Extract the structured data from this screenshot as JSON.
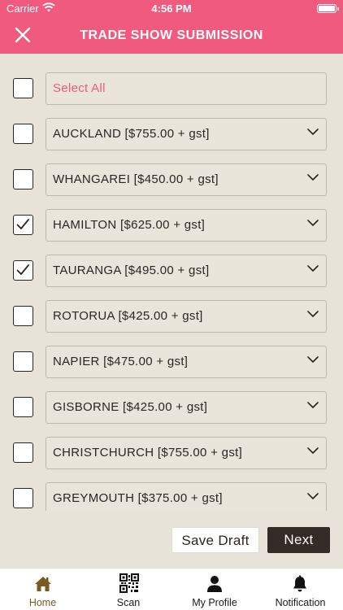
{
  "status_bar": {
    "carrier": "Carrier",
    "time": "4:56 PM"
  },
  "nav": {
    "title": "TRADE SHOW SUBMISSION"
  },
  "select_all": {
    "label": "Select All",
    "checked": false
  },
  "shows": [
    {
      "label": "AUCKLAND [$755.00 + gst]",
      "checked": false
    },
    {
      "label": "WHANGAREI [$450.00 + gst]",
      "checked": false
    },
    {
      "label": "HAMILTON [$625.00 + gst]",
      "checked": true
    },
    {
      "label": "TAURANGA [$495.00 + gst]",
      "checked": true
    },
    {
      "label": "ROTORUA [$425.00 + gst]",
      "checked": false
    },
    {
      "label": "NAPIER [$475.00 + gst]",
      "checked": false
    },
    {
      "label": "GISBORNE [$425.00 + gst]",
      "checked": false
    },
    {
      "label": "CHRISTCHURCH [$755.00 + gst]",
      "checked": false
    },
    {
      "label": "GREYMOUTH [$375.00 + gst]",
      "checked": false
    }
  ],
  "actions": {
    "save_draft": "Save Draft",
    "next": "Next"
  },
  "tabs": [
    {
      "label": "Home",
      "icon": "home-icon",
      "active": true
    },
    {
      "label": "Scan",
      "icon": "qr-code-icon",
      "active": false
    },
    {
      "label": "My Profile",
      "icon": "user-icon",
      "active": false
    },
    {
      "label": "Notification",
      "icon": "bell-icon",
      "active": false
    }
  ],
  "colors": {
    "brand": "#f05a7e",
    "background": "#e7e3d9",
    "dark_button": "#332b25",
    "active_tab": "#7a5a22"
  }
}
